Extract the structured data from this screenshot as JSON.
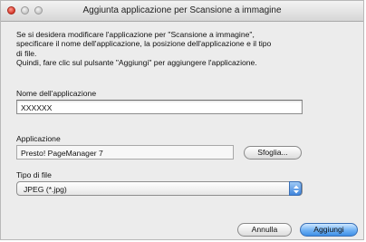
{
  "window": {
    "title": "Aggiunta applicazione per Scansione a immagine"
  },
  "description": {
    "lines": [
      "Se si desidera modificare l'applicazione per \"Scansione a immagine\",",
      "specificare il nome dell'applicazione, la posizione dell'applicazione e il tipo",
      "di file.",
      "Quindi, fare clic sul pulsante \"Aggiungi\" per aggiungere l'applicazione."
    ]
  },
  "app_name": {
    "label": "Nome dell'applicazione",
    "value": "XXXXXX"
  },
  "application": {
    "label": "Applicazione",
    "value": "Presto! PageManager 7",
    "browse_label": "Sfoglia..."
  },
  "file_type": {
    "label": "Tipo di file",
    "selected": "JPEG (*.jpg)"
  },
  "footer": {
    "cancel_label": "Annulla",
    "add_label": "Aggiungi"
  }
}
